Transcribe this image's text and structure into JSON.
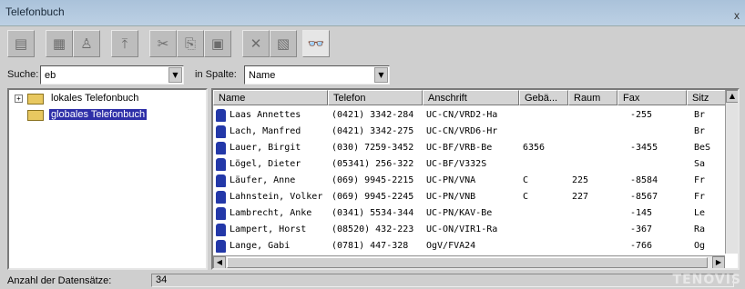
{
  "window": {
    "title": "Telefonbuch",
    "close": "x"
  },
  "toolbar": {
    "buttons": [
      {
        "icon": "open-folder-icon",
        "glyph": "▤"
      },
      {
        "icon": "new-folder-icon",
        "glyph": "▦"
      },
      {
        "icon": "user-icon",
        "glyph": "♙"
      },
      {
        "icon": "import-icon",
        "glyph": "⤒"
      },
      {
        "icon": "cut-icon",
        "glyph": "✂"
      },
      {
        "icon": "copy-icon",
        "glyph": "⎘"
      },
      {
        "icon": "paste-icon",
        "glyph": "▣"
      },
      {
        "icon": "delete-icon",
        "glyph": "✕"
      },
      {
        "icon": "properties-icon",
        "glyph": "▧"
      },
      {
        "icon": "binoculars-icon",
        "glyph": "👓"
      }
    ]
  },
  "search": {
    "label": "Suche:",
    "value": "eb",
    "column_label": "in Spalte:",
    "column_value": "Name"
  },
  "tree": {
    "items": [
      {
        "label": "lokales Telefonbuch",
        "expander": "+"
      },
      {
        "label": "globales Telefonbuch",
        "selected": true
      }
    ]
  },
  "grid": {
    "columns": [
      "Name",
      "Telefon",
      "Anschrift",
      "Gebä...",
      "Raum",
      "Fax",
      "Sitz"
    ],
    "rows": [
      [
        "Laas Annettes",
        "(0421) 3342-284",
        "UC-CN/VRD2-Ha",
        "",
        "",
        "-255",
        "Br"
      ],
      [
        "Lach, Manfred",
        "(0421) 3342-275",
        "UC-CN/VRD6-Hr",
        "",
        "",
        "",
        "Br"
      ],
      [
        "Lauer, Birgit",
        "(030) 7259-3452",
        "UC-BF/VRB-Be",
        "6356",
        "",
        "-3455",
        "BeS"
      ],
      [
        "Lögel, Dieter",
        "(05341) 256-322",
        "UC-BF/V332S",
        "",
        "",
        "",
        "Sa"
      ],
      [
        "Läufer, Anne",
        "(069) 9945-2215",
        "UC-PN/VNA",
        "C",
        "225",
        "-8584",
        "Fr"
      ],
      [
        "Lahnstein, Volker",
        "(069) 9945-2245",
        "UC-PN/VNB",
        "C",
        "227",
        "-8567",
        "Fr"
      ],
      [
        "Lambrecht, Anke",
        "(0341) 5534-344",
        "UC-PN/KAV-Be",
        "",
        "",
        "-145",
        "Le"
      ],
      [
        "Lampert, Horst",
        "(08520) 432-223",
        "UC-ON/VIR1-Ra",
        "",
        "",
        "-367",
        "Ra"
      ],
      [
        "Lange, Gabi",
        "(0781) 447-328",
        "OgV/FVA24",
        "",
        "",
        "-766",
        "Og"
      ]
    ]
  },
  "status": {
    "label": "Anzahl der Datensätze:",
    "count": "34"
  },
  "watermark": "TENOVIS"
}
